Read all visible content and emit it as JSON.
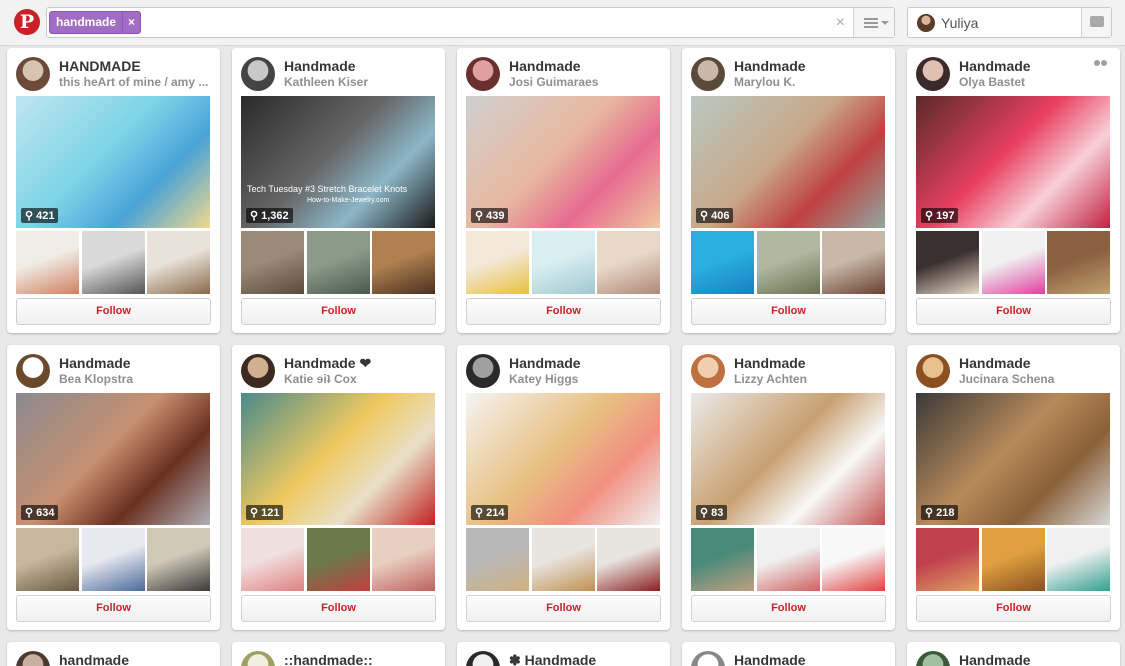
{
  "header": {
    "logo_glyph": "P",
    "search_token": "handmade",
    "token_remove": "×",
    "clear_glyph": "×",
    "user_name": "Yuliya"
  },
  "boards": [
    {
      "title": "HANDMADE",
      "owner": "this heArt of mine / amy ...",
      "pins": "421",
      "follow": "Follow",
      "avatar": [
        "#d8c2b0",
        "#6b4a3a"
      ],
      "main": [
        "#bfe6f0",
        "#7bd3e6",
        "#4aa3d8",
        "#f0d88a"
      ],
      "thumbs": [
        [
          "#f0ece6",
          "#d08060"
        ],
        [
          "#dadada",
          "#555"
        ],
        [
          "#e8e2da",
          "#8a6a4a"
        ]
      ]
    },
    {
      "title": "Handmade",
      "owner": "Kathleen Kiser",
      "pins": "1,362",
      "follow": "Follow",
      "avatar": [
        "#c8c8c8",
        "#444"
      ],
      "main": [
        "#2a2a2a",
        "#666",
        "#8cb7c7",
        "#1a1a1a"
      ],
      "overlay": [
        "Tech Tuesday #3 Stretch Bracelet Knots",
        "How-to-Make-Jewelry.com"
      ],
      "thumbs": [
        [
          "#9a8a78",
          "#5a4a3a"
        ],
        [
          "#8c9a8a",
          "#4a5a4a"
        ],
        [
          "#b08050",
          "#4a3020"
        ]
      ]
    },
    {
      "title": "Handmade",
      "owner": "Josi Guimaraes",
      "pins": "439",
      "follow": "Follow",
      "avatar": [
        "#e0a0a0",
        "#6a3030"
      ],
      "main": [
        "#cfcfcf",
        "#e8b8a0",
        "#e86a90",
        "#f0c8a0"
      ],
      "thumbs": [
        [
          "#f4e8d8",
          "#e8c040"
        ],
        [
          "#d8eef0",
          "#a0c8d0"
        ],
        [
          "#e8d8c8",
          "#b08878"
        ]
      ]
    },
    {
      "title": "Handmade",
      "owner": "Marylou K.",
      "pins": "406",
      "follow": "Follow",
      "avatar": [
        "#c8b8a8",
        "#5a4a3a"
      ],
      "main": [
        "#b8c8c0",
        "#c8a88a",
        "#c04040",
        "#90a8a0"
      ],
      "thumbs": [
        [
          "#2ab0e0",
          "#1880c0"
        ],
        [
          "#b0b8a0",
          "#6a7050"
        ],
        [
          "#c8b8a8",
          "#6a4030"
        ]
      ]
    },
    {
      "title": "Handmade",
      "owner": "Olya Bastet",
      "pins": "197",
      "follow": "Follow",
      "group": true,
      "avatar": [
        "#e0c0b0",
        "#3a2a2a"
      ],
      "main": [
        "#5a2a2a",
        "#e84060",
        "#f8d0d8",
        "#c02040"
      ],
      "thumbs": [
        [
          "#3a3030",
          "#e8d8c8"
        ],
        [
          "#f0f0f0",
          "#e040a0"
        ],
        [
          "#8a6040",
          "#c0a070"
        ]
      ]
    },
    {
      "title": "Handmade",
      "owner": "Bea Klopstra",
      "pins": "634",
      "follow": "Follow",
      "avatar": [
        "#ffffff",
        "#6a4a2a"
      ],
      "main": [
        "#8a8a90",
        "#c89070",
        "#6a3020",
        "#b0b0b8"
      ],
      "thumbs": [
        [
          "#c8b8a0",
          "#6a5a40"
        ],
        [
          "#e8e8f0",
          "#4a6a9a"
        ],
        [
          "#d0c8b8",
          "#3a3a3a"
        ]
      ]
    },
    {
      "title": "Handmade ❤",
      "owner": "Katie ɘiʇ Cox",
      "pins": "121",
      "follow": "Follow",
      "avatar": [
        "#d0b090",
        "#3a2a20"
      ],
      "main": [
        "#4a8a88",
        "#f0c860",
        "#e8e0c8",
        "#c02020"
      ],
      "thumbs": [
        [
          "#f0e0e0",
          "#e08080"
        ],
        [
          "#6a7a4a",
          "#c04040"
        ],
        [
          "#e8d0c0",
          "#c06060"
        ]
      ]
    },
    {
      "title": "Handmade",
      "owner": "Katey Higgs",
      "pins": "214",
      "follow": "Follow",
      "avatar": [
        "#a0a0a0",
        "#2a2a2a"
      ],
      "main": [
        "#f4f4f4",
        "#e8c080",
        "#f09080",
        "#f0f0f0"
      ],
      "thumbs": [
        [
          "#b8b8b8",
          "#d0b080"
        ],
        [
          "#e8e4e0",
          "#c09050"
        ],
        [
          "#e8e4e0",
          "#8a2020"
        ]
      ]
    },
    {
      "title": "Handmade",
      "owner": "Lizzy Achten",
      "pins": "83",
      "follow": "Follow",
      "avatar": [
        "#f0d0b0",
        "#c07040"
      ],
      "main": [
        "#eaeaea",
        "#c8a070",
        "#f8f8f8",
        "#c05050"
      ],
      "thumbs": [
        [
          "#4a8a7a",
          "#c0a080"
        ],
        [
          "#f0f0f0",
          "#d06060"
        ],
        [
          "#f8f8f8",
          "#e04040"
        ]
      ]
    },
    {
      "title": "Handmade",
      "owner": "Jucinara Schena",
      "pins": "218",
      "follow": "Follow",
      "avatar": [
        "#e8c090",
        "#8a5020"
      ],
      "main": [
        "#3a3a3a",
        "#b88a5a",
        "#8a6038",
        "#d8d8d8"
      ],
      "thumbs": [
        [
          "#c04050",
          "#e0a060"
        ],
        [
          "#e0a040",
          "#8a5020"
        ],
        [
          "#f0f0f0",
          "#30a090"
        ]
      ]
    }
  ],
  "next_row": [
    {
      "title": "handmade",
      "avatar": [
        "#c8b0a0",
        "#4a3a30"
      ]
    },
    {
      "title": "::handmade::",
      "avatar": [
        "#f0f0e0",
        "#a0a060"
      ]
    },
    {
      "title": "✽ Handmade",
      "avatar": [
        "#f0f0f0",
        "#2a2a2a"
      ]
    },
    {
      "title": "Handmade",
      "avatar": [
        "#ffffff",
        "#888888"
      ]
    },
    {
      "title": "Handmade",
      "avatar": [
        "#a0c0a0",
        "#3a5a3a"
      ]
    }
  ]
}
